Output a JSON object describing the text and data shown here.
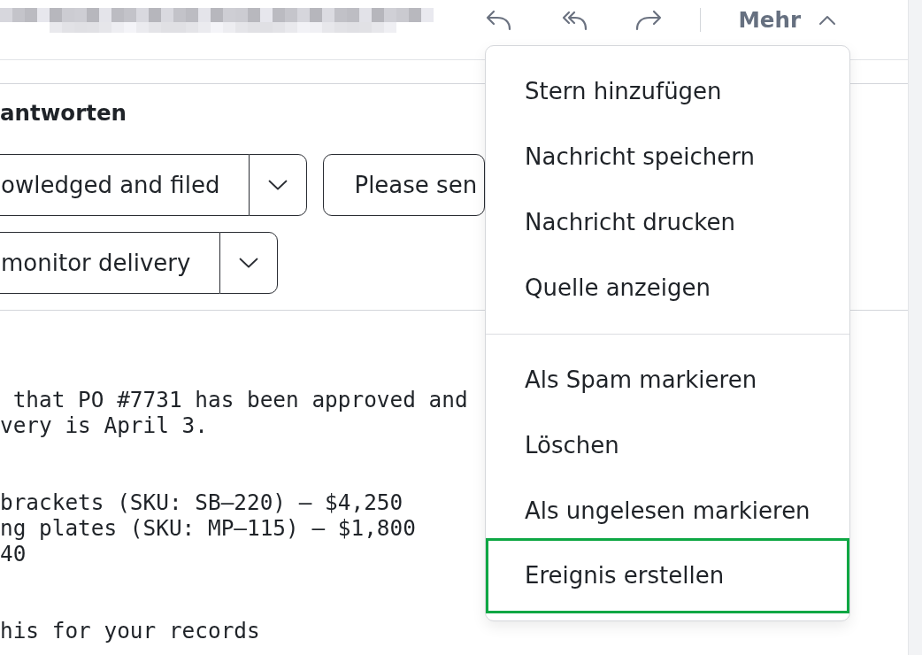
{
  "toolbar": {
    "more": {
      "label": "Mehr",
      "expanded": true
    }
  },
  "quick_replies": {
    "heading": "antworten",
    "rows": [
      [
        {
          "kind": "split",
          "label": "owledged and filed"
        },
        {
          "kind": "plain",
          "label": "Please sen"
        }
      ],
      [
        {
          "kind": "split",
          "label": "monitor delivery"
        }
      ]
    ]
  },
  "message_body": {
    "paragraphs": [
      [
        " that PO #7731 has been approved and",
        "very is April 3."
      ],
      [
        "brackets (SKU: SB–220) — $4,250",
        "ng plates (SKU: MP–115) — $1,800",
        "40"
      ],
      [
        "his for your records"
      ]
    ]
  },
  "more_menu": {
    "sections": [
      {
        "items": [
          {
            "label": "Stern hinzufügen",
            "focused": false
          },
          {
            "label": "Nachricht speichern",
            "focused": false
          },
          {
            "label": "Nachricht drucken",
            "focused": false
          },
          {
            "label": "Quelle anzeigen",
            "focused": false
          }
        ]
      },
      {
        "items": [
          {
            "label": "Als Spam markieren",
            "focused": false
          },
          {
            "label": "Löschen",
            "focused": false
          },
          {
            "label": "Als ungelesen markieren",
            "focused": false
          },
          {
            "label": "Ereignis erstellen",
            "focused": true
          }
        ]
      }
    ]
  }
}
